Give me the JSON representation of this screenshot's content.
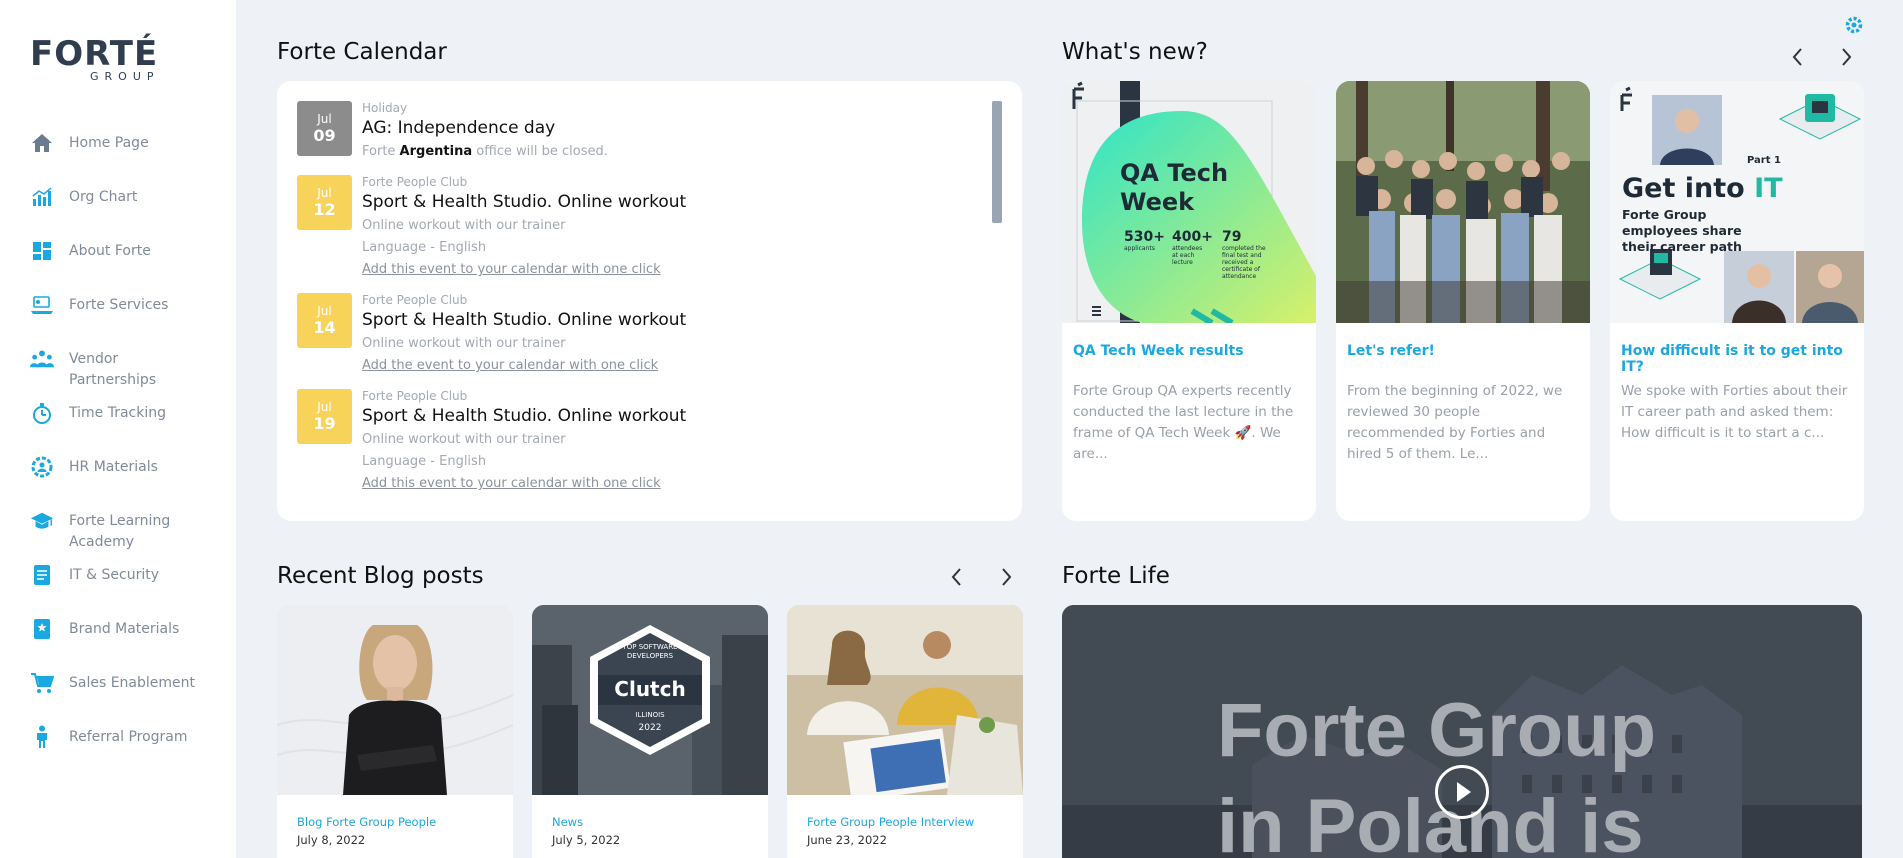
{
  "brand": {
    "logo_main": "FORTÉ",
    "logo_sub": "GROUP",
    "accent": "#1aa8e0"
  },
  "sidebar": {
    "items": [
      {
        "label": "Home Page",
        "icon": "home-icon"
      },
      {
        "label": "Org Chart",
        "icon": "chart-icon"
      },
      {
        "label": "About Forte",
        "icon": "grid-icon"
      },
      {
        "label": "Forte Services",
        "icon": "services-icon"
      },
      {
        "label": "Vendor Partnerships",
        "icon": "people-icon"
      },
      {
        "label": "Time Tracking",
        "icon": "stopwatch-icon"
      },
      {
        "label": "HR Materials",
        "icon": "gear-person-icon"
      },
      {
        "label": "Forte Learning Academy",
        "icon": "graduation-cap-icon"
      },
      {
        "label": "IT & Security",
        "icon": "document-icon"
      },
      {
        "label": "Brand Materials",
        "icon": "book-icon"
      },
      {
        "label": "Sales Enablement",
        "icon": "cart-icon"
      },
      {
        "label": "Referral Program",
        "icon": "person-icon"
      }
    ]
  },
  "calendar": {
    "title": "Forte Calendar",
    "events": [
      {
        "month": "Jul",
        "day": "09",
        "category": "Holiday",
        "title": "AG: Independence day",
        "line_pre": "Forte ",
        "line_bold": "Argentina",
        "line_post": " office will be closed."
      },
      {
        "month": "Jul",
        "day": "12",
        "category": "Forte People Club",
        "title": "Sport & Health Studio. Online workout",
        "desc": "Online workout with our trainer",
        "lang": "Language - English",
        "link": "Add this event to your calendar with one click"
      },
      {
        "month": "Jul",
        "day": "14",
        "category": "Forte People Club",
        "title": "Sport & Health Studio. Online workout",
        "desc": "Online workout with our trainer",
        "link": "Add the event to your calendar with one click "
      },
      {
        "month": "Jul",
        "day": "19",
        "category": "Forte People Club",
        "title": "Sport & Health Studio. Online workout",
        "desc": "Online workout with our trainer",
        "lang": "Language - English",
        "link": "Add this event to your calendar with one click"
      }
    ]
  },
  "whats_new": {
    "title": "What's new?",
    "cards": [
      {
        "title": "QA Tech Week results",
        "text": "Forte Group QA experts recently conducted the last lecture in the frame of QA Tech Week 🚀. We are...",
        "img_heading": "QA Tech Week",
        "stats": [
          {
            "num": "530+",
            "label": "applicants"
          },
          {
            "num": "400+",
            "label": "attendees at each lecture"
          },
          {
            "num": "79",
            "label": "completed the final test and received a certificate of attendance"
          }
        ]
      },
      {
        "title": "Let's refer!",
        "text": "From the beginning of 2022, we reviewed 30 people recommended by Forties and hired 5 of them. Le..."
      },
      {
        "title": "How difficult is it to get into IT?",
        "text": "We spoke with Forties about their IT career path and asked them: How difficult is it to start a c...",
        "img_part": "Part 1",
        "img_heading_a": "Get into ",
        "img_heading_b": "IT",
        "img_sub": "Forte Group employees share their career path"
      }
    ]
  },
  "blog": {
    "title": "Recent Blog posts",
    "posts": [
      {
        "category": "Blog Forte Group People",
        "date": "July 8, 2022"
      },
      {
        "category": "News",
        "date": "July 5, 2022",
        "badge_top": "TOP SOFTWARE DEVELOPERS",
        "badge_name": "Clutch",
        "badge_loc": "ILLINOIS",
        "badge_year": "2022"
      },
      {
        "category": "Forte Group People Interview",
        "date": "June 23, 2022"
      }
    ]
  },
  "life": {
    "title": "Forte Life",
    "video_line1": "Forte Group",
    "video_line2": "in Poland is"
  }
}
